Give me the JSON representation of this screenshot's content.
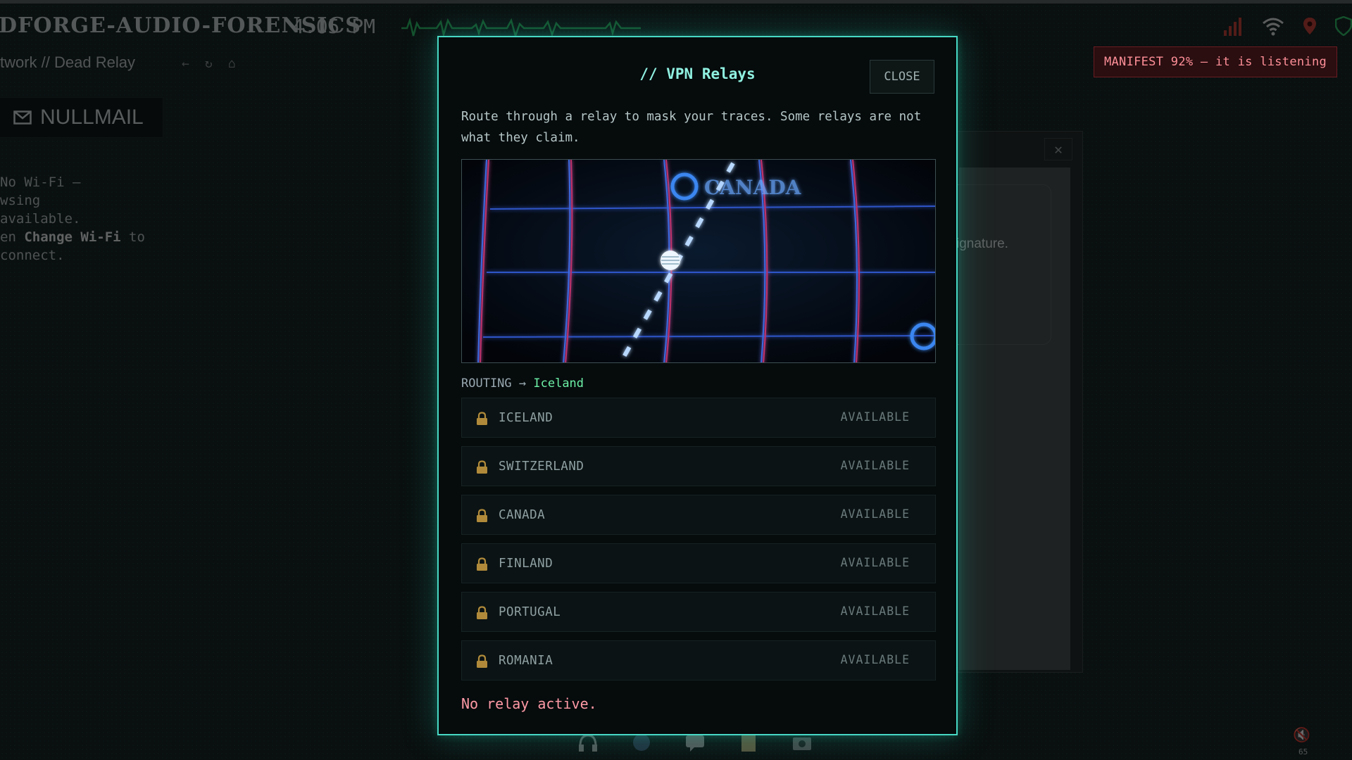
{
  "app": {
    "title": "DFORGE-AUDIO-FORENSICS",
    "clock": "4:05 PM"
  },
  "browser": {
    "address": "twork // Dead Relay",
    "nav": [
      "←",
      "↻",
      "⌂"
    ]
  },
  "mail": {
    "button_label": "NULLMAIL",
    "icon": "mail-icon"
  },
  "wifi_note": {
    "prefix": "No Wi-Fi —\nwsing\navailable.\nen ",
    "bold": "Change Wi-Fi",
    "suffix": " to\nconnect."
  },
  "background_window": {
    "close": "✕",
    "text": "ignature."
  },
  "notification": {
    "text": "MANIFEST 92% — it is listening"
  },
  "vpn_modal": {
    "title": "// VPN Relays",
    "close_label": "CLOSE",
    "description": "Route through a relay to mask your traces. Some relays are not what they claim.",
    "map": {
      "label": "CANADA"
    },
    "routing_label": "ROUTING →",
    "routing_target": "Iceland",
    "relays": [
      {
        "name": "ICELAND",
        "status": "AVAILABLE"
      },
      {
        "name": "SWITZERLAND",
        "status": "AVAILABLE"
      },
      {
        "name": "CANADA",
        "status": "AVAILABLE"
      },
      {
        "name": "FINLAND",
        "status": "AVAILABLE"
      },
      {
        "name": "PORTUGAL",
        "status": "AVAILABLE"
      },
      {
        "name": "ROMANIA",
        "status": "AVAILABLE"
      }
    ],
    "status_message": "No relay active."
  },
  "system": {
    "volume": "65"
  },
  "colors": {
    "accent": "#47d8c4",
    "danger": "#ff8f98",
    "routing": "#6cf0a6",
    "lock": "#b08a3a"
  }
}
